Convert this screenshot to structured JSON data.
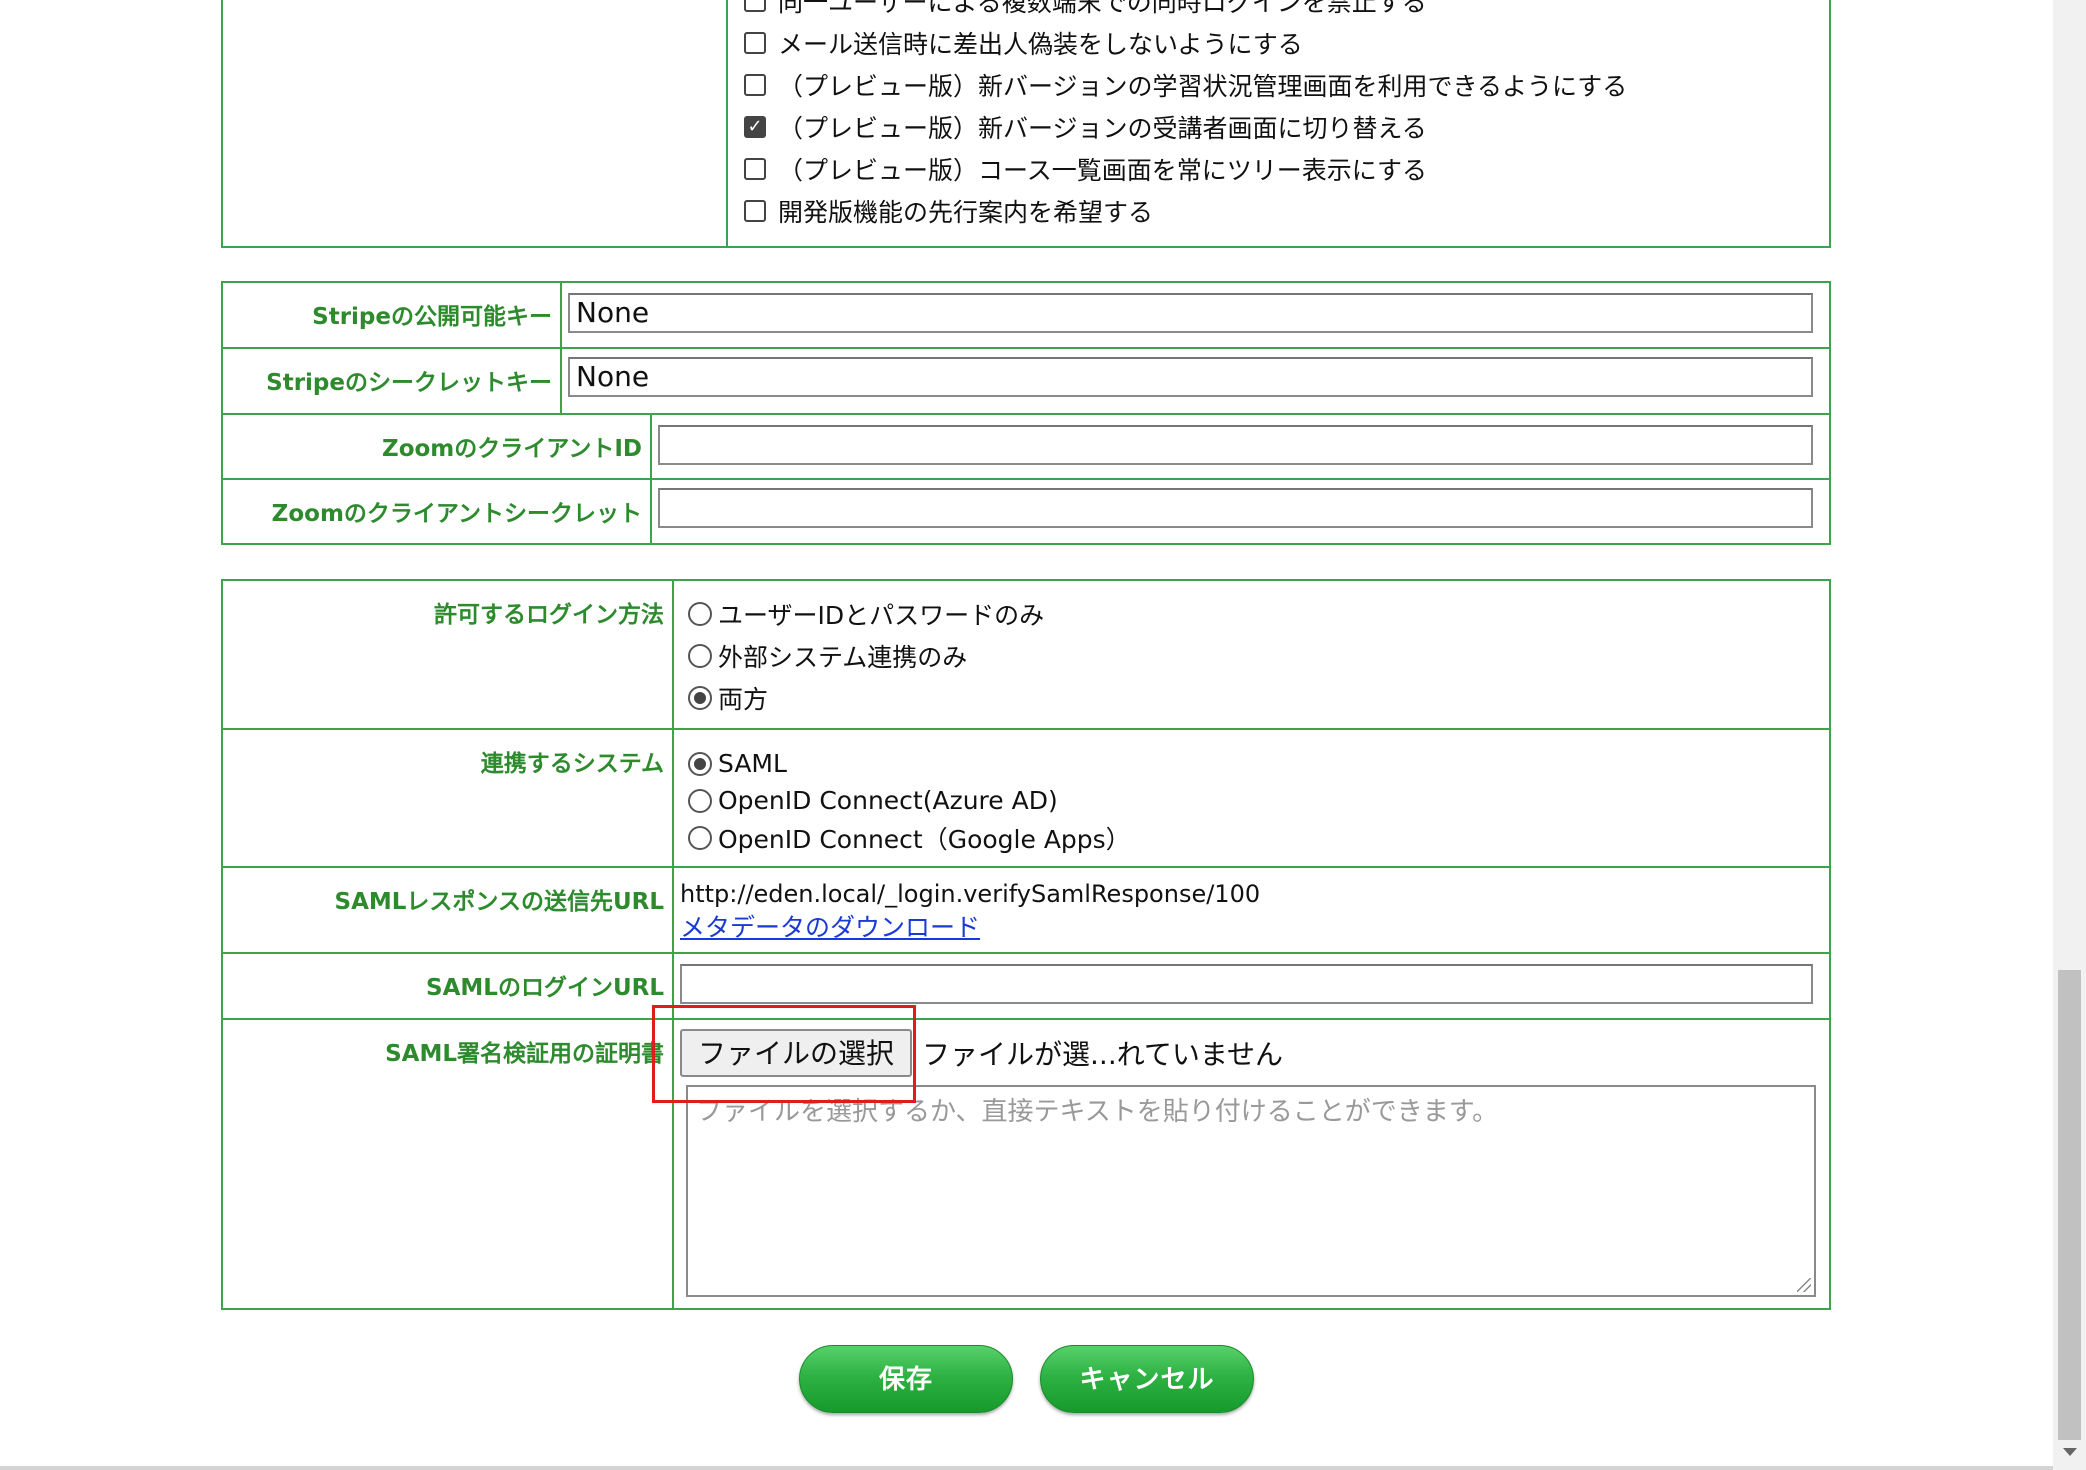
{
  "options": {
    "items": [
      {
        "label": "同一ユーザーによる複数端末での同時ログインを禁止する",
        "checked": false
      },
      {
        "label": "メール送信時に差出人偽装をしないようにする",
        "checked": false
      },
      {
        "label": "（プレビュー版）新バージョンの学習状況管理画面を利用できるようにする",
        "checked": false
      },
      {
        "label": "（プレビュー版）新バージョンの受講者画面に切り替える",
        "checked": true
      },
      {
        "label": "（プレビュー版）コース一覧画面を常にツリー表示にする",
        "checked": false
      },
      {
        "label": "開発版機能の先行案内を希望する",
        "checked": false
      }
    ]
  },
  "stripe": {
    "public_key_label": "Stripeの公開可能キー",
    "public_key_value": "None",
    "secret_key_label": "Stripeのシークレットキー",
    "secret_key_value": "None"
  },
  "zoom": {
    "client_id_label": "ZoomのクライアントID",
    "client_id_value": "",
    "client_secret_label": "Zoomのクライアントシークレット",
    "client_secret_value": ""
  },
  "login": {
    "method_label": "許可するログイン方法",
    "methods": [
      {
        "label": "ユーザーIDとパスワードのみ",
        "selected": false
      },
      {
        "label": "外部システム連携のみ",
        "selected": false
      },
      {
        "label": "両方",
        "selected": true
      }
    ],
    "system_label": "連携するシステム",
    "systems": [
      {
        "label": "SAML",
        "selected": true
      },
      {
        "label": "OpenID Connect(Azure AD)",
        "selected": false
      },
      {
        "label": "OpenID Connect（Google Apps）",
        "selected": false
      }
    ]
  },
  "saml": {
    "response_url_label": "SAMLレスポンスの送信先URL",
    "response_url": "http://eden.local/_login.verifySamlResponse/100",
    "metadata_link": "メタデータのダウンロード",
    "login_url_label": "SAMLのログインURL",
    "login_url_value": "",
    "cert_label": "SAML署名検証用の証明書",
    "file_button": "ファイルの選択",
    "file_status": "ファイルが選...れていません",
    "cert_placeholder": "ファイルを選択するか、直接テキストを貼り付けることができます。"
  },
  "actions": {
    "save": "保存",
    "cancel": "キャンセル"
  },
  "colors": {
    "label_green": "#2d8a2d",
    "border_green": "#3fa34d",
    "button_green": "#2fb244",
    "highlight_red": "#e21b1b",
    "link_blue": "#1a3ad6"
  }
}
